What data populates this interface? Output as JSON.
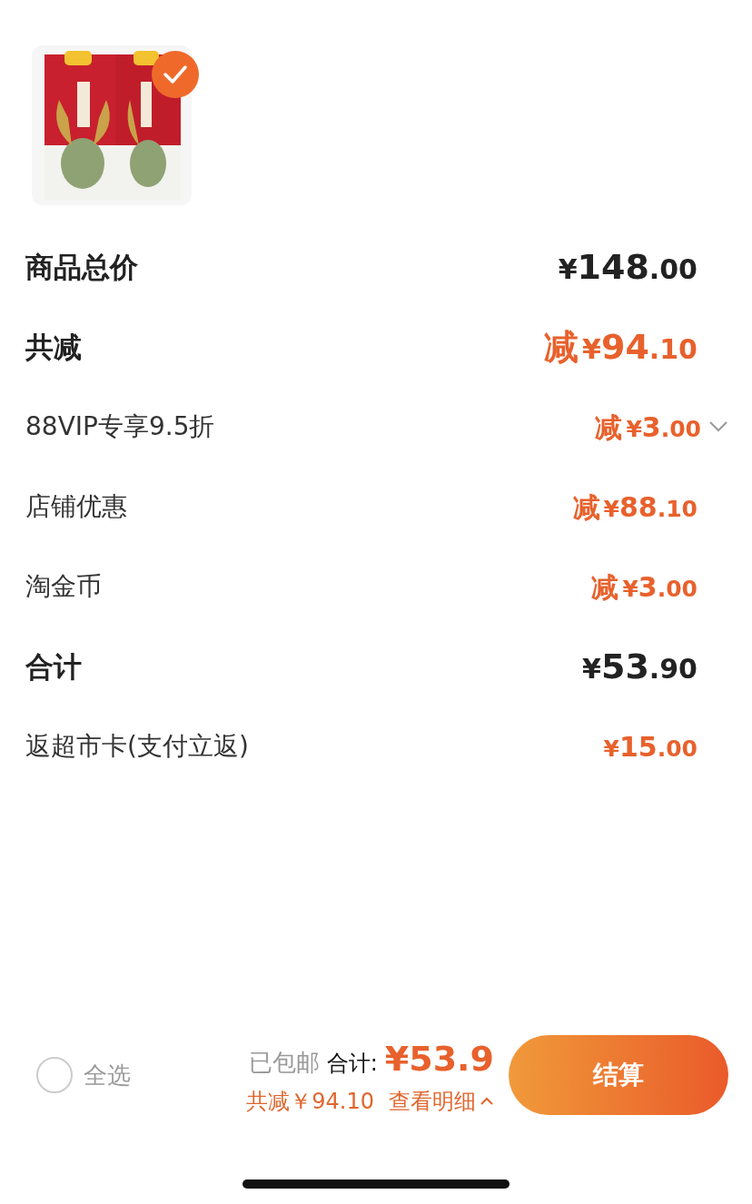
{
  "product": {
    "kind": "picture",
    "selected": true
  },
  "rows": [
    {
      "kind": "heading",
      "label": "商品总价",
      "amount": "¥148.00",
      "discount": false,
      "expandable": false
    },
    {
      "kind": "heading",
      "label": "共减",
      "prefix": "减",
      "amount": "¥94.10",
      "discount": true,
      "expandable": false
    },
    {
      "kind": "detail",
      "label": "88VIP专享9.5折",
      "prefix": "减",
      "amount": "¥3.00",
      "discount": true,
      "expandable": true
    },
    {
      "kind": "detail",
      "label": "店铺优惠",
      "prefix": "减",
      "amount": "¥88.10",
      "discount": true,
      "expandable": false
    },
    {
      "kind": "detail",
      "label": "淘金币",
      "prefix": "减",
      "amount": "¥3.00",
      "discount": true,
      "expandable": false
    },
    {
      "kind": "heading",
      "label": "合计",
      "amount": "¥53.90",
      "discount": false,
      "expandable": false
    },
    {
      "kind": "detail",
      "label": "返超市卡(支付立返)",
      "amount": "¥15.00",
      "discount": true,
      "expandable": false
    }
  ],
  "footer": {
    "select_all": {
      "label": "全选",
      "checked": false
    },
    "shipping": "已包邮",
    "total_label": "合计:",
    "total": "¥53.9",
    "savings": "共减￥94.10",
    "details_link": "查看明细",
    "checkout": "结算"
  }
}
